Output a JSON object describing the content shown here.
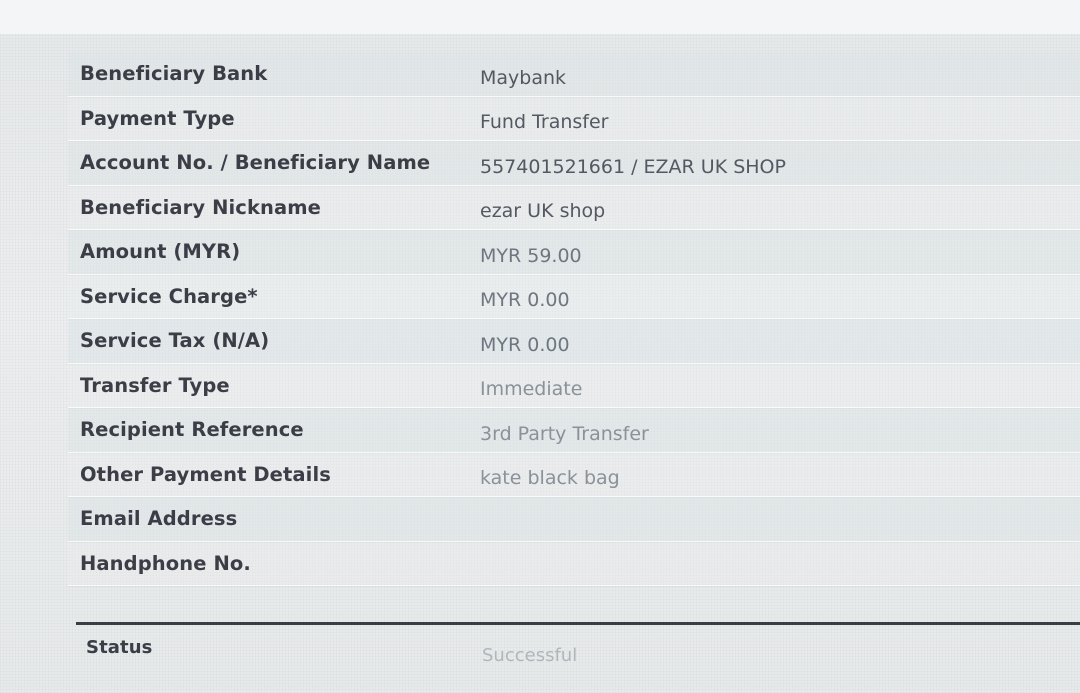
{
  "transaction_details": {
    "rows": [
      {
        "label": "Beneficiary Bank",
        "value": "Maybank"
      },
      {
        "label": "Payment Type",
        "value": "Fund Transfer"
      },
      {
        "label": "Account No. / Beneficiary Name",
        "value": "557401521661 / EZAR UK SHOP"
      },
      {
        "label": "Beneficiary Nickname",
        "value": "ezar UK shop"
      },
      {
        "label": "Amount (MYR)",
        "value": "MYR 59.00"
      },
      {
        "label": "Service Charge*",
        "value": "MYR 0.00"
      },
      {
        "label": "Service Tax (N/A)",
        "value": "MYR 0.00"
      },
      {
        "label": "Transfer Type",
        "value": "Immediate"
      },
      {
        "label": "Recipient Reference",
        "value": "3rd Party Transfer"
      },
      {
        "label": "Other Payment Details",
        "value": "kate black bag"
      },
      {
        "label": "Email Address",
        "value": ""
      },
      {
        "label": "Handphone No.",
        "value": ""
      }
    ]
  },
  "status": {
    "label": "Status",
    "value": "Successful"
  },
  "colors": {
    "label_text": "#3b3e47",
    "value_text": "#545862",
    "divider": "#3a3e44",
    "background": "#e9eced"
  }
}
